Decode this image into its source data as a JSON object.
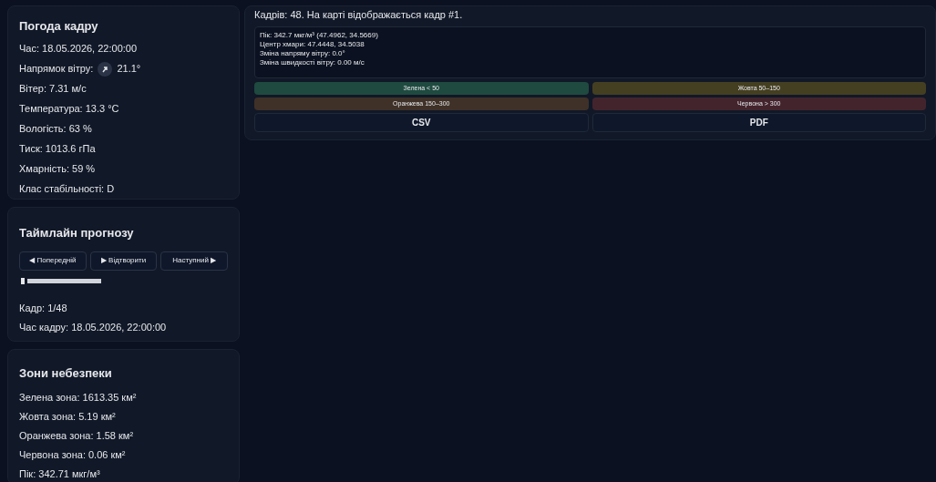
{
  "weather": {
    "title": "Погода кадру",
    "lines": [
      {
        "kind": "text",
        "text": "Час: 18.05.2026, 22:00:00"
      },
      {
        "kind": "wind",
        "text": "Напрямок вітру:",
        "value": "21.1°"
      },
      {
        "kind": "text",
        "text": "Вітер: 7.31 м/с"
      },
      {
        "kind": "text",
        "text": "Температура: 13.3 °C"
      },
      {
        "kind": "text",
        "text": "Вологість: 63 %"
      },
      {
        "kind": "text",
        "text": "Тиск: 1013.6 гПа"
      },
      {
        "kind": "text",
        "text": "Хмарність: 59 %"
      },
      {
        "kind": "text",
        "text": "Клас стабільності: D"
      }
    ]
  },
  "timeline": {
    "title": "Таймлайн прогнозу",
    "buttons": [
      "◀ Попередній",
      "▶ Відтворити",
      "Наступний ▶"
    ],
    "slider": {
      "level": 0
    },
    "frame": "Кадр: 1/48",
    "frame_time": "Час кадру: 18.05.2026, 22:00:00"
  },
  "zones": {
    "title": "Зони небезпеки",
    "lines": [
      "Зелена зона: 1613.35 км²",
      "Жовта зона: 5.19 км²",
      "Оранжева зона: 1.58 км²",
      "Червона зона: 0.06 км²",
      "Пік: 342.71 мкг/м³"
    ]
  },
  "summary": {
    "heading": "Кадрів: 48. На карті відображається кадр #1.",
    "details": [
      "Пік: 342.7 мкг/м³ (47.4962, 34.5669)",
      "Центр хмари: 47.4448, 34.5038",
      "Зміна напряму вітру: 0.0°",
      "Зміна швидкості вітру: 0.00 м/с"
    ],
    "legend": [
      {
        "label": "Зелена < 50",
        "color": "#1f4a3f"
      },
      {
        "label": "Жовта 50–150",
        "color": "#453f22"
      },
      {
        "label": "Оранжева 150–300",
        "color": "#3f3127"
      },
      {
        "label": "Червона > 300",
        "color": "#43242d"
      }
    ],
    "exports": [
      "CSV",
      "PDF"
    ]
  }
}
